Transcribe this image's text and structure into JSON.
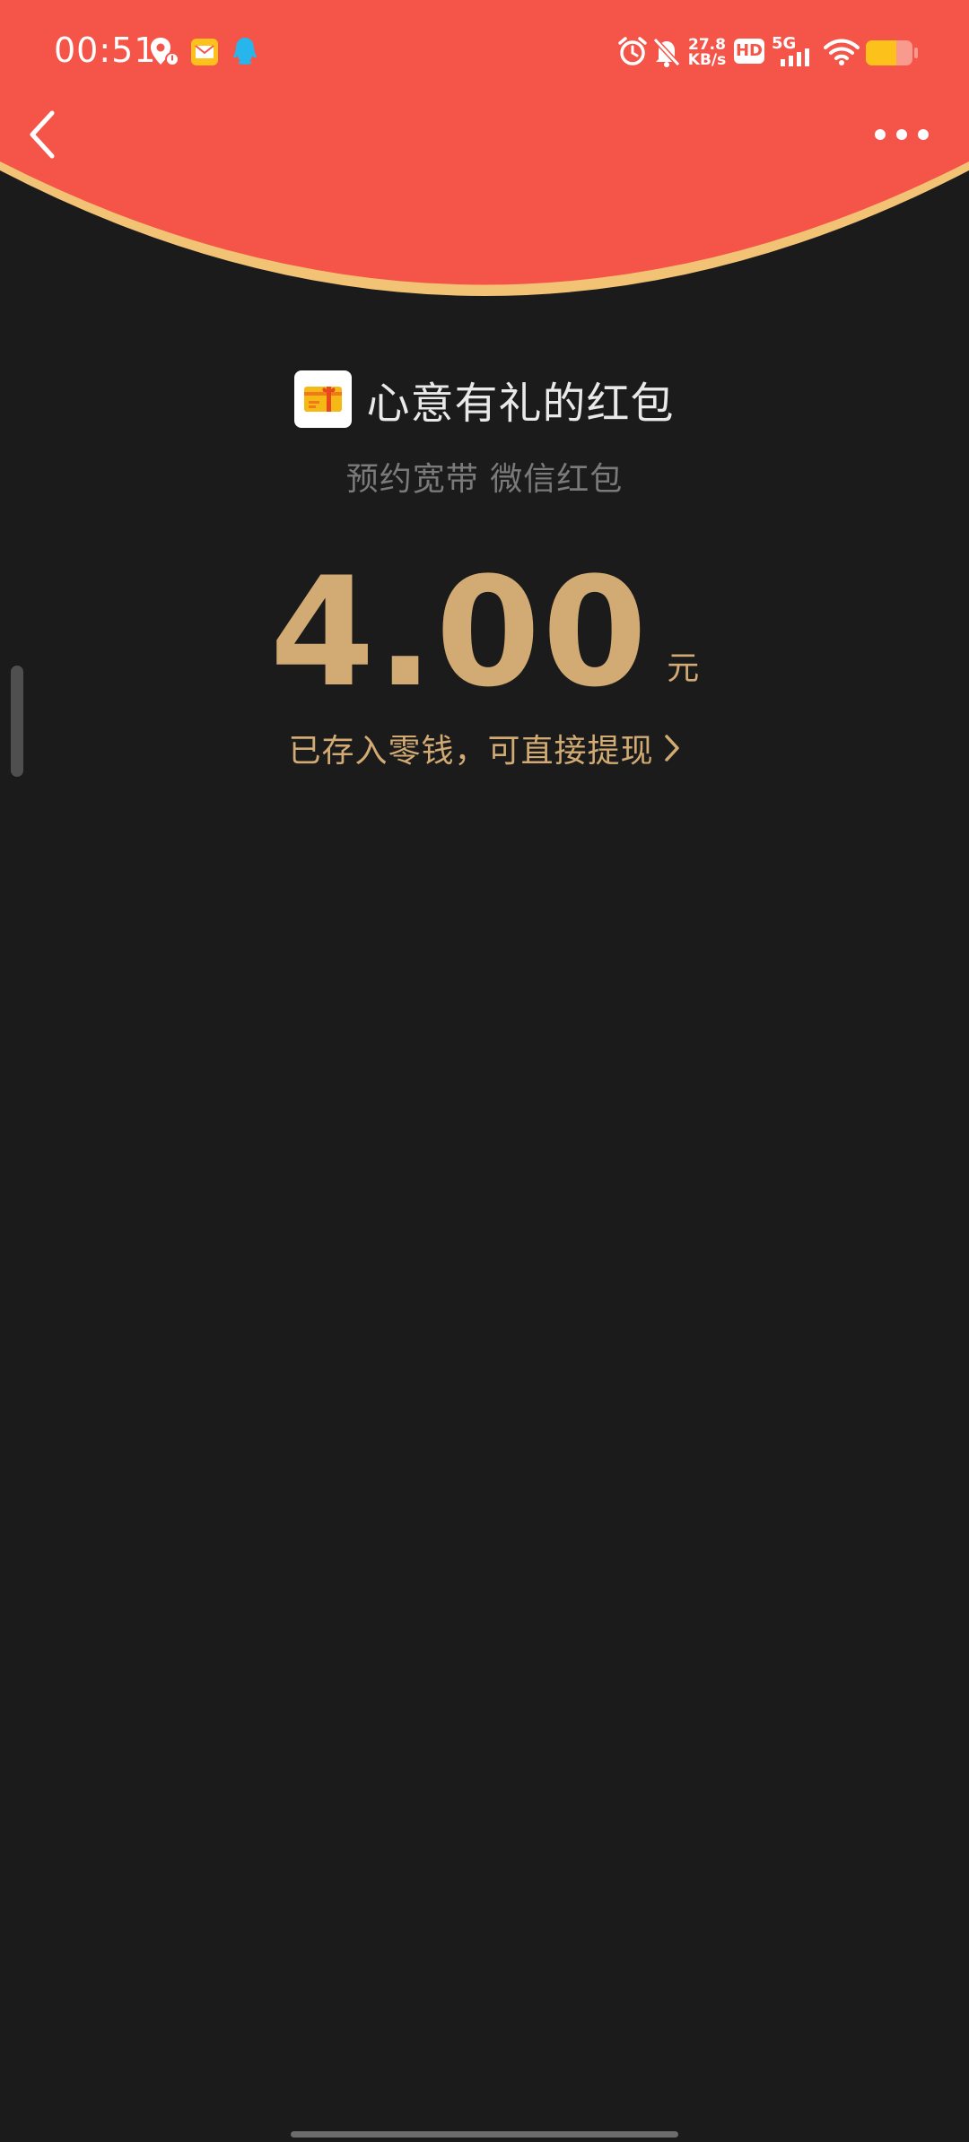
{
  "status_bar": {
    "time": "00:51",
    "net_speed_value": "27.8",
    "net_speed_unit": "KB/s",
    "hd_label": "HD",
    "network_label": "5G",
    "icons": [
      "location-icon",
      "mail-icon",
      "qq-icon",
      "alarm-icon",
      "mute-icon",
      "hd-icon",
      "signal-icon",
      "wifi-icon",
      "battery-icon"
    ]
  },
  "nav": {
    "back_icon": "chevron-left-icon",
    "more_icon": "more-dots-icon"
  },
  "red_packet": {
    "sender_name": "心意有礼的红包",
    "wish": "预约宽带 微信红包",
    "amount": "4.00",
    "unit": "元",
    "saved_text": "已存入零钱，可直接提现"
  },
  "colors": {
    "header_red": "#f55548",
    "header_border": "#f2c275",
    "gold": "#d1ab73",
    "background": "#1b1b1b"
  }
}
